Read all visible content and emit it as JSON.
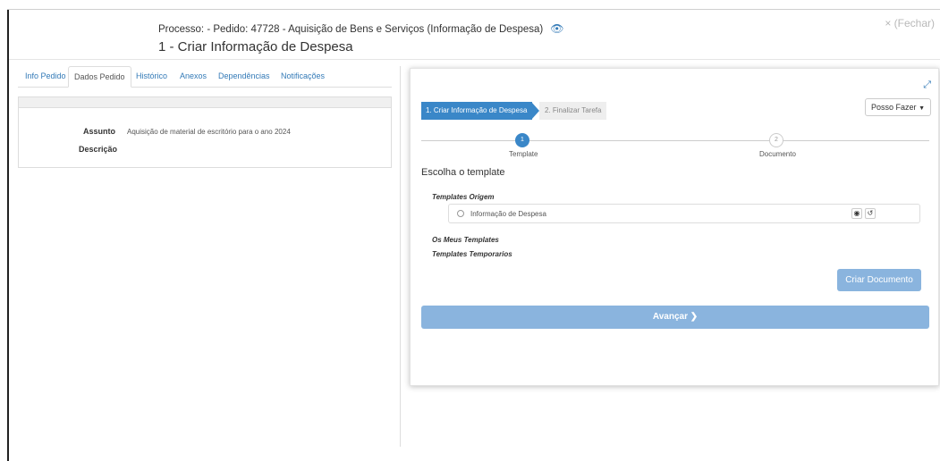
{
  "header": {
    "process_line": "Processo: - Pedido: 47728 - Aquisição de Bens e Serviços (Informação de Despesa)",
    "title": "1 - Criar Informação de Despesa",
    "close_label": "× (Fechar)"
  },
  "tabs": [
    {
      "label": "Info Pedido"
    },
    {
      "label": "Dados Pedido"
    },
    {
      "label": "Histórico"
    },
    {
      "label": "Anexos"
    },
    {
      "label": "Dependências"
    },
    {
      "label": "Notificações"
    }
  ],
  "active_tab": "Dados Pedido",
  "details": {
    "assunto_label": "Assunto",
    "assunto_value": "Aquisição de material de escritório para o ano 2024",
    "descricao_label": "Descrição"
  },
  "wizard": {
    "step1_label": "1. Criar Informação de Despesa",
    "step2_label": "2. Finalizar Tarefa",
    "actions_label": "Posso Fazer",
    "progress": {
      "step1_number": "1",
      "step1_name": "Template",
      "step2_number": "2",
      "step2_name": "Documento"
    },
    "heading": "Escolha o template",
    "templates_origem_label": "Templates Origem",
    "template_item": "Informação de Despesa",
    "meus_templates_label": "Os Meus Templates",
    "temporarios_label": "Templates Temporarios",
    "criar_button": "Criar Documento",
    "avancar_button": "Avançar"
  },
  "colors": {
    "accent": "#3a87c8",
    "button_disabled": "#8ab4de",
    "link": "#337ab7"
  }
}
